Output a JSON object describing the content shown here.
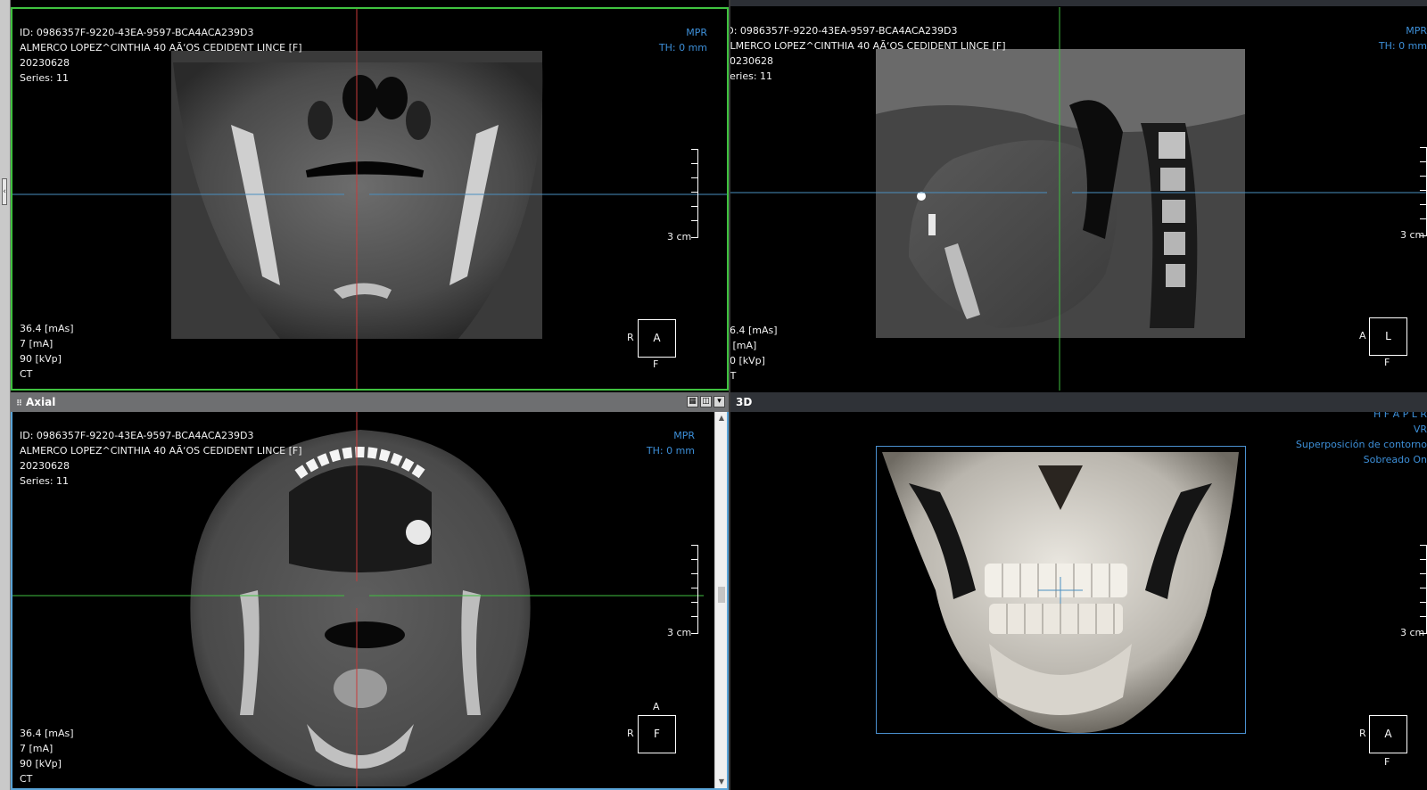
{
  "patient": {
    "id": "ID: 0986357F-9220-43EA-9597-BCA4ACA239D3",
    "name": "ALMERCO LOPEZ^CINTHIA 40 AÃ‘OS CEDIDENT LINCE [F]",
    "date": "20230628",
    "series": "Series: 11"
  },
  "acquisition": {
    "mas": "36.4 [mAs]",
    "ma": "7 [mA]",
    "kvp": "90 [kVp]",
    "modality": "CT"
  },
  "mpr_info": {
    "mode": "MPR",
    "thickness": "TH: 0 mm"
  },
  "scale_label": "3 cm",
  "coronal": {
    "orient_center": "A",
    "orient_left": "R",
    "orient_bottom": "F"
  },
  "sagittal": {
    "orient_center": "L",
    "orient_left": "A",
    "orient_bottom": "F"
  },
  "axial": {
    "title": "Axial",
    "orient_center": "F",
    "orient_left": "R",
    "orient_top": "A",
    "orient_bottom": ""
  },
  "vr": {
    "title": "3D",
    "directions": "H F A P L R",
    "mode": "VR",
    "overlay1": "Superposición de contorno",
    "overlay2": "Sobreado On",
    "orient_center": "A",
    "orient_left": "R",
    "orient_bottom": "F"
  },
  "colors": {
    "active_border": "#3fc23f",
    "axial_border": "#5aa4d8",
    "info_blue": "#3d8fd8",
    "crosshair_red": "#c83a3a",
    "crosshair_green": "#3fbf3f",
    "crosshair_blue": "#4a8fc0"
  },
  "icons": [
    "layout-grid-icon",
    "window-toggle-icon",
    "dropdown-arrow-icon"
  ]
}
